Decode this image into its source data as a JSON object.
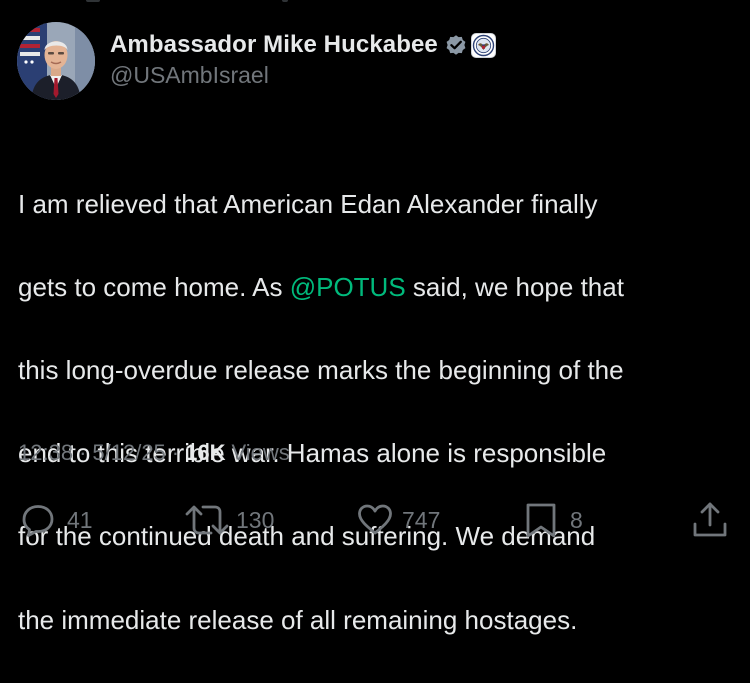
{
  "tweet": {
    "author": {
      "display_name": "Ambassador Mike Huckabee",
      "handle": "@USAmbIsrael",
      "verified": true,
      "verified_color": "#8b98a5"
    },
    "text_lines": [
      [
        "I am relieved that American Edan Alexander finally"
      ],
      [
        "gets to come home. As ",
        "@POTUS",
        " said, we hope that"
      ],
      [
        "this long-overdue release marks the beginning of the"
      ],
      [
        "end to this terrible war. Hamas alone is responsible"
      ],
      [
        "for the continued death and suffering. We demand"
      ],
      [
        "the immediate release of all remaining hostages."
      ]
    ],
    "mention": "@POTUS",
    "line1": "I am relieved that American Edan Alexander finally",
    "line2_before": "gets to come home. As ",
    "line2_after": " said, we hope that",
    "line3": "this long-overdue release marks the beginning of the",
    "line4": "end to this terrible war. Hamas alone is responsible",
    "line5": "for the continued death and suffering. We demand",
    "line6": "the immediate release of all remaining hostages.",
    "meta": {
      "time": "12:38",
      "separator": "·",
      "date": "5/12/25",
      "views_count": "16K",
      "views_label": "Views"
    },
    "actions": {
      "replies": "41",
      "reposts": "130",
      "likes": "747",
      "bookmarks": "8",
      "reply_icon": "speech-bubble-icon",
      "repost_icon": "repost-arrows-icon",
      "like_icon": "heart-icon",
      "bookmark_icon": "bookmark-icon",
      "share_icon": "share-upload-icon"
    }
  },
  "colors": {
    "background": "#000000",
    "text_primary": "#e7e9ea",
    "text_secondary": "#71767b",
    "mention": "#00ba7c"
  }
}
